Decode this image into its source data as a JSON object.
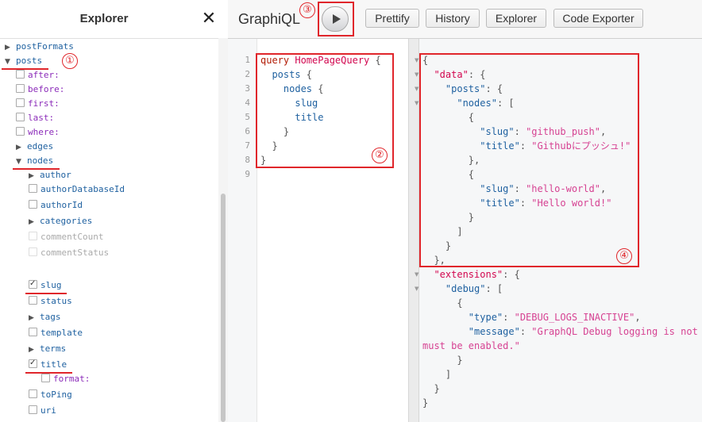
{
  "explorer": {
    "title": "Explorer",
    "close_label": "✕",
    "items": [
      {
        "label": "postFormats",
        "kind": "field",
        "control": "arrow-right",
        "depth": 0
      },
      {
        "label": "posts",
        "kind": "field",
        "control": "arrow-down",
        "depth": 0,
        "underlined": true
      },
      {
        "label": "after:",
        "kind": "arg",
        "control": "checkbox",
        "checked": false,
        "depth": 1
      },
      {
        "label": "before:",
        "kind": "arg",
        "control": "checkbox",
        "checked": false,
        "depth": 1
      },
      {
        "label": "first:",
        "kind": "arg",
        "control": "checkbox",
        "checked": false,
        "depth": 1
      },
      {
        "label": "last:",
        "kind": "arg",
        "control": "checkbox",
        "checked": false,
        "depth": 1
      },
      {
        "label": "where:",
        "kind": "arg",
        "control": "checkbox",
        "checked": false,
        "depth": 1
      },
      {
        "label": "edges",
        "kind": "field",
        "control": "arrow-right",
        "depth": 1
      },
      {
        "label": "nodes",
        "kind": "field",
        "control": "arrow-down",
        "depth": 1,
        "underlined": true
      },
      {
        "label": "author",
        "kind": "field",
        "control": "arrow-right",
        "depth": 2
      },
      {
        "label": "authorDatabaseId",
        "kind": "field",
        "control": "checkbox",
        "checked": false,
        "depth": 2
      },
      {
        "label": "authorId",
        "kind": "field",
        "control": "checkbox",
        "checked": false,
        "depth": 2
      },
      {
        "label": "categories",
        "kind": "field",
        "control": "arrow-right",
        "depth": 2
      },
      {
        "label": "commentCount",
        "kind": "faded",
        "control": "checkbox",
        "checked": false,
        "depth": 2
      },
      {
        "label": "commentStatus",
        "kind": "faded",
        "control": "checkbox",
        "checked": false,
        "depth": 2
      },
      {
        "label": "slug",
        "kind": "field",
        "control": "checkbox",
        "checked": true,
        "depth": 2,
        "underlined": true
      },
      {
        "label": "status",
        "kind": "field",
        "control": "checkbox",
        "checked": false,
        "depth": 2
      },
      {
        "label": "tags",
        "kind": "field",
        "control": "arrow-right",
        "depth": 2
      },
      {
        "label": "template",
        "kind": "field",
        "control": "checkbox",
        "checked": false,
        "depth": 2
      },
      {
        "label": "terms",
        "kind": "field",
        "control": "arrow-right",
        "depth": 2
      },
      {
        "label": "title",
        "kind": "field",
        "control": "checkbox",
        "checked": true,
        "depth": 2,
        "underlined": true
      },
      {
        "label": "format:",
        "kind": "arg",
        "control": "checkbox",
        "checked": false,
        "depth": 3
      },
      {
        "label": "toPing",
        "kind": "field",
        "control": "checkbox",
        "checked": false,
        "depth": 2
      },
      {
        "label": "uri",
        "kind": "field",
        "control": "checkbox",
        "checked": false,
        "depth": 2
      }
    ]
  },
  "toolbar": {
    "logo": "GraphiQL",
    "buttons": [
      {
        "label": "Prettify"
      },
      {
        "label": "History"
      },
      {
        "label": "Explorer"
      },
      {
        "label": "Code Exporter"
      }
    ]
  },
  "query": {
    "line_numbers": [
      "1",
      "2",
      "3",
      "4",
      "5",
      "6",
      "7",
      "8",
      "9"
    ],
    "lines": [
      [
        {
          "t": "query",
          "c": "kw"
        },
        {
          "t": " ",
          "c": "pn"
        },
        {
          "t": "HomePageQuery",
          "c": "def"
        },
        {
          "t": " {",
          "c": "pn"
        }
      ],
      [
        {
          "t": "  ",
          "c": "pn"
        },
        {
          "t": "posts",
          "c": "fld"
        },
        {
          "t": " {",
          "c": "pn"
        }
      ],
      [
        {
          "t": "    ",
          "c": "pn"
        },
        {
          "t": "nodes",
          "c": "fld"
        },
        {
          "t": " {",
          "c": "pn"
        }
      ],
      [
        {
          "t": "      ",
          "c": "pn"
        },
        {
          "t": "slug",
          "c": "fld"
        }
      ],
      [
        {
          "t": "      ",
          "c": "pn"
        },
        {
          "t": "title",
          "c": "fld"
        }
      ],
      [
        {
          "t": "    }",
          "c": "pn"
        }
      ],
      [
        {
          "t": "  }",
          "c": "pn"
        }
      ],
      [
        {
          "t": "}",
          "c": "pn"
        }
      ],
      []
    ]
  },
  "result": {
    "lines": [
      {
        "fold": true,
        "parts": [
          {
            "t": "{",
            "c": "pn"
          }
        ]
      },
      {
        "fold": true,
        "parts": [
          {
            "t": "  ",
            "c": "pn"
          },
          {
            "t": "\"data\"",
            "c": "def"
          },
          {
            "t": ": {",
            "c": "pn"
          }
        ]
      },
      {
        "fold": true,
        "parts": [
          {
            "t": "    ",
            "c": "pn"
          },
          {
            "t": "\"posts\"",
            "c": "fld"
          },
          {
            "t": ": {",
            "c": "pn"
          }
        ]
      },
      {
        "fold": true,
        "parts": [
          {
            "t": "      ",
            "c": "pn"
          },
          {
            "t": "\"nodes\"",
            "c": "fld"
          },
          {
            "t": ": [",
            "c": "pn"
          }
        ]
      },
      {
        "fold": false,
        "parts": [
          {
            "t": "        {",
            "c": "pn"
          }
        ]
      },
      {
        "fold": false,
        "parts": [
          {
            "t": "          ",
            "c": "pn"
          },
          {
            "t": "\"slug\"",
            "c": "fld"
          },
          {
            "t": ": ",
            "c": "pn"
          },
          {
            "t": "\"github_push\"",
            "c": "str"
          },
          {
            "t": ",",
            "c": "pn"
          }
        ]
      },
      {
        "fold": false,
        "parts": [
          {
            "t": "          ",
            "c": "pn"
          },
          {
            "t": "\"title\"",
            "c": "fld"
          },
          {
            "t": ": ",
            "c": "pn"
          },
          {
            "t": "\"Githubにプッシュ!\"",
            "c": "str"
          }
        ]
      },
      {
        "fold": false,
        "parts": [
          {
            "t": "        },",
            "c": "pn"
          }
        ]
      },
      {
        "fold": false,
        "parts": [
          {
            "t": "        {",
            "c": "pn"
          }
        ]
      },
      {
        "fold": false,
        "parts": [
          {
            "t": "          ",
            "c": "pn"
          },
          {
            "t": "\"slug\"",
            "c": "fld"
          },
          {
            "t": ": ",
            "c": "pn"
          },
          {
            "t": "\"hello-world\"",
            "c": "str"
          },
          {
            "t": ",",
            "c": "pn"
          }
        ]
      },
      {
        "fold": false,
        "parts": [
          {
            "t": "          ",
            "c": "pn"
          },
          {
            "t": "\"title\"",
            "c": "fld"
          },
          {
            "t": ": ",
            "c": "pn"
          },
          {
            "t": "\"Hello world!\"",
            "c": "str"
          }
        ]
      },
      {
        "fold": false,
        "parts": [
          {
            "t": "        }",
            "c": "pn"
          }
        ]
      },
      {
        "fold": false,
        "parts": [
          {
            "t": "      ]",
            "c": "pn"
          }
        ]
      },
      {
        "fold": false,
        "parts": [
          {
            "t": "    }",
            "c": "pn"
          }
        ]
      },
      {
        "fold": false,
        "parts": [
          {
            "t": "  },",
            "c": "pn"
          }
        ]
      },
      {
        "fold": true,
        "parts": [
          {
            "t": "  ",
            "c": "pn"
          },
          {
            "t": "\"extensions\"",
            "c": "def"
          },
          {
            "t": ": {",
            "c": "pn"
          }
        ]
      },
      {
        "fold": true,
        "parts": [
          {
            "t": "    ",
            "c": "pn"
          },
          {
            "t": "\"debug\"",
            "c": "fld"
          },
          {
            "t": ": [",
            "c": "pn"
          }
        ]
      },
      {
        "fold": false,
        "parts": [
          {
            "t": "      {",
            "c": "pn"
          }
        ]
      },
      {
        "fold": false,
        "parts": [
          {
            "t": "        ",
            "c": "pn"
          },
          {
            "t": "\"type\"",
            "c": "fld"
          },
          {
            "t": ": ",
            "c": "pn"
          },
          {
            "t": "\"DEBUG_LOGS_INACTIVE\"",
            "c": "str"
          },
          {
            "t": ",",
            "c": "pn"
          }
        ]
      },
      {
        "fold": false,
        "parts": [
          {
            "t": "        ",
            "c": "pn"
          },
          {
            "t": "\"message\"",
            "c": "fld"
          },
          {
            "t": ": ",
            "c": "pn"
          },
          {
            "t": "\"GraphQL Debug logging is not",
            "c": "str"
          }
        ]
      },
      {
        "fold": false,
        "parts": [
          {
            "t": "must be enabled.\"",
            "c": "str"
          }
        ]
      },
      {
        "fold": false,
        "parts": [
          {
            "t": "      }",
            "c": "pn"
          }
        ]
      },
      {
        "fold": false,
        "parts": [
          {
            "t": "    ]",
            "c": "pn"
          }
        ]
      },
      {
        "fold": false,
        "parts": [
          {
            "t": "  }",
            "c": "pn"
          }
        ]
      },
      {
        "fold": false,
        "parts": [
          {
            "t": "}",
            "c": "pn"
          }
        ]
      }
    ]
  },
  "annotations": {
    "badges": [
      "①",
      "②",
      "③",
      "④"
    ],
    "color": "#e0262b"
  }
}
